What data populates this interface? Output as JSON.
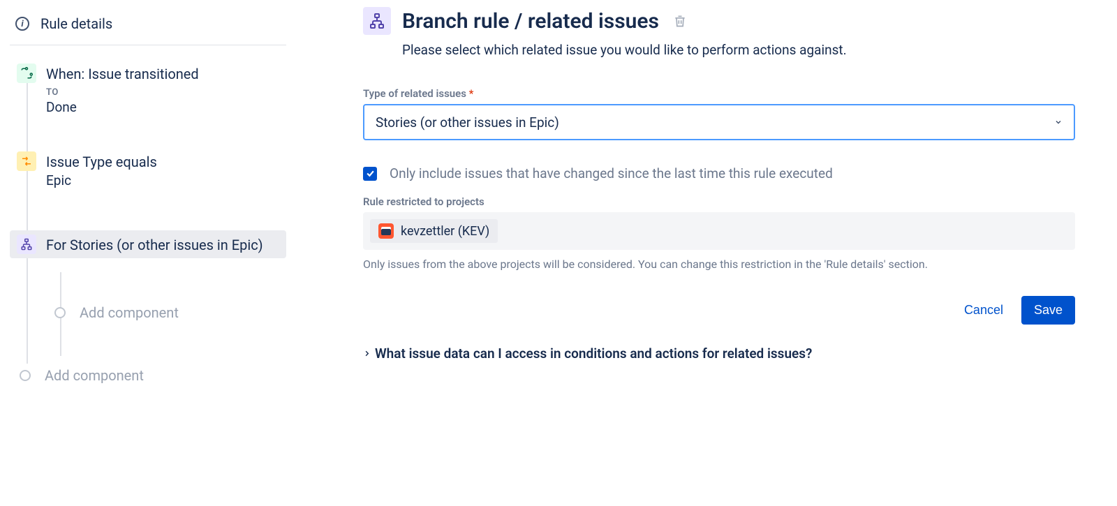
{
  "sidebar": {
    "rule_details": "Rule details",
    "nodes": {
      "trigger": {
        "title": "When: Issue transitioned",
        "to_label": "TO",
        "to_value": "Done"
      },
      "condition": {
        "title": "Issue Type equals",
        "value": "Epic"
      },
      "branch": {
        "title": "For Stories (or other issues in Epic)"
      }
    },
    "add_component": "Add component"
  },
  "main": {
    "title": "Branch rule / related issues",
    "description": "Please select which related issue you would like to perform actions against.",
    "type_label": "Type of related issues",
    "type_value": "Stories (or other issues in Epic)",
    "only_changed": "Only include issues that have changed since the last time this rule executed",
    "restricted_label": "Rule restricted to projects",
    "project_name": "kevzettler (KEV)",
    "restricted_help": "Only issues from the above projects will be considered. You can change this restriction in the 'Rule details' section.",
    "cancel": "Cancel",
    "save": "Save",
    "expander_question": "What issue data can I access in conditions and actions for related issues?"
  }
}
